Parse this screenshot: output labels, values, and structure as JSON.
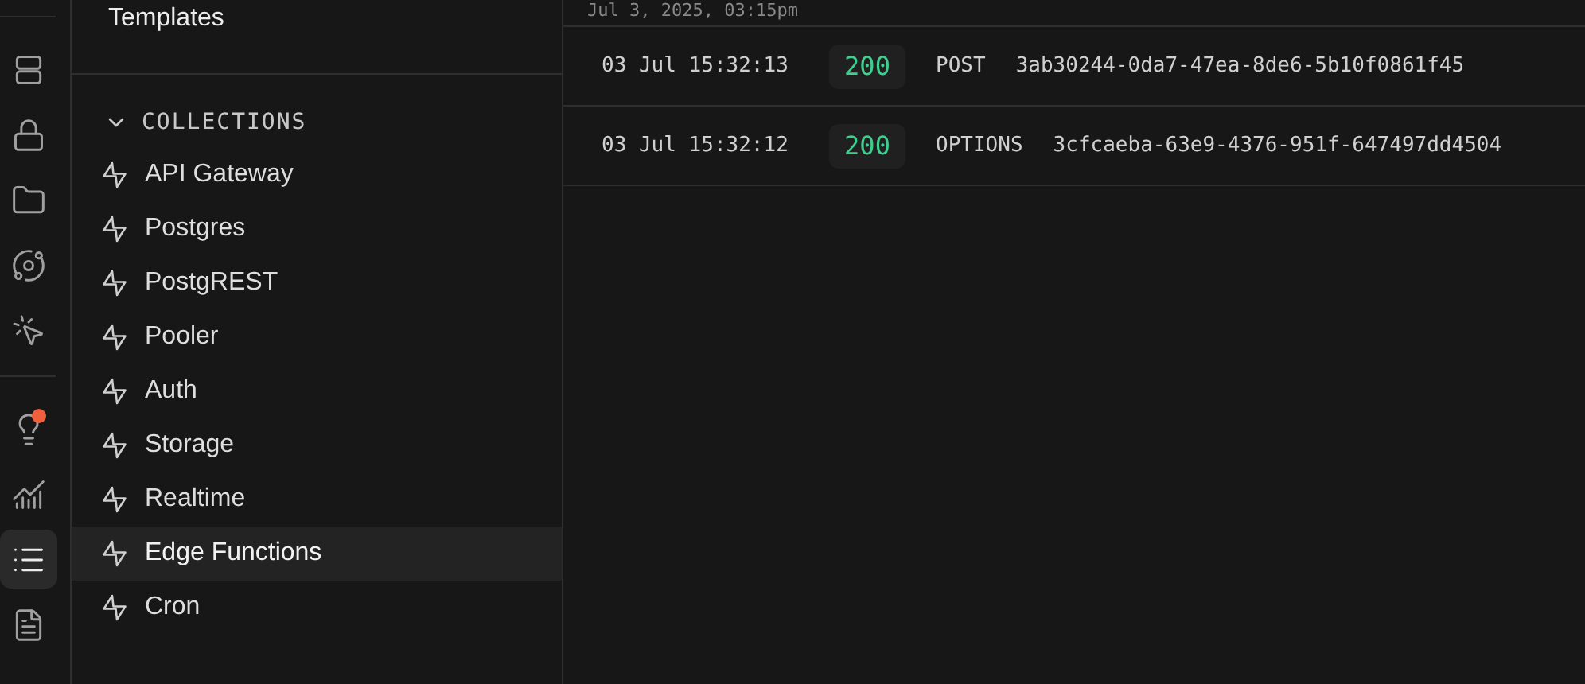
{
  "rail": {
    "groups": [
      [
        {
          "selected": false,
          "alert": false
        },
        {
          "selected": false,
          "alert": false
        },
        {
          "selected": false,
          "alert": false
        },
        {
          "selected": false,
          "alert": false
        },
        {
          "selected": false,
          "alert": false
        }
      ],
      [
        {
          "selected": false,
          "alert": true
        },
        {
          "selected": false,
          "alert": false
        },
        {
          "selected": true,
          "alert": false
        },
        {
          "selected": false,
          "alert": false
        }
      ]
    ]
  },
  "sidebar": {
    "top_item": "Templates",
    "section": {
      "title": "COLLECTIONS",
      "expanded": true,
      "items": [
        {
          "label": "API Gateway",
          "selected": false
        },
        {
          "label": "Postgres",
          "selected": false
        },
        {
          "label": "PostgREST",
          "selected": false
        },
        {
          "label": "Pooler",
          "selected": false
        },
        {
          "label": "Auth",
          "selected": false
        },
        {
          "label": "Storage",
          "selected": false
        },
        {
          "label": "Realtime",
          "selected": false
        },
        {
          "label": "Edge Functions",
          "selected": true
        },
        {
          "label": "Cron",
          "selected": false
        }
      ]
    }
  },
  "log": {
    "header": "Jul 3, 2025, 03:15pm",
    "rows": [
      {
        "time": "03 Jul 15:32:13",
        "status": "200",
        "method": "POST",
        "id": "3ab30244-0da7-47ea-8de6-5b10f0861f45"
      },
      {
        "time": "03 Jul 15:32:12",
        "status": "200",
        "method": "OPTIONS",
        "id": "3cfcaeba-63e9-4376-951f-647497dd4504"
      }
    ]
  }
}
